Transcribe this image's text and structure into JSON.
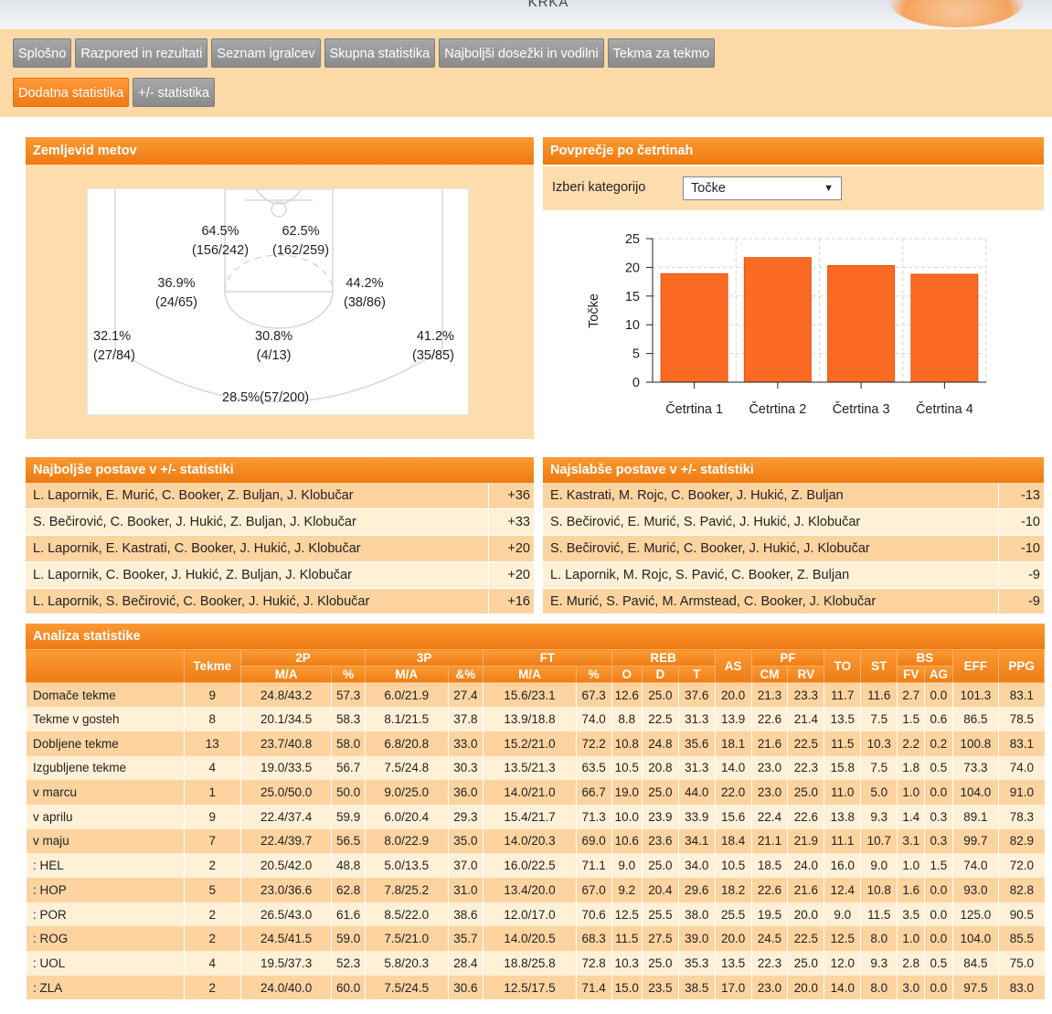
{
  "header": {
    "title": "KRKA"
  },
  "nav": {
    "row1": [
      "Splošno",
      "Razpored in rezultati",
      "Seznam igralcev",
      "Skupna statistika",
      "Najboljši dosežki in vodilni",
      "Tekma za tekmo"
    ],
    "row2": [
      "Dodatna statistika",
      "+/- statistika"
    ],
    "active": "Dodatna statistika"
  },
  "shot_map": {
    "title": "Zemljevid metov",
    "zones": {
      "paint_left": [
        "64.5%",
        "(156/242)"
      ],
      "paint_right": [
        "62.5%",
        "(162/259)"
      ],
      "mid_left": [
        "36.9%",
        "(24/65)"
      ],
      "mid_right": [
        "44.2%",
        "(38/86)"
      ],
      "corner_left": [
        "32.1%",
        "(27/84)"
      ],
      "top_key": [
        "30.8%",
        "(4/13)"
      ],
      "corner_right": [
        "41.2%",
        "(35/85)"
      ],
      "three_top": "28.5%(57/200)"
    }
  },
  "quarters": {
    "title": "Povprečje po četrtinah",
    "select_label": "Izberi kategorijo",
    "select_value": "Točke",
    "colors": {
      "bar": "#fb6a22",
      "bar_stroke": "#e25510"
    }
  },
  "chart_data": {
    "type": "bar",
    "categories": [
      "Četrtina 1",
      "Četrtina 2",
      "Četrtina 3",
      "Četrtina 4"
    ],
    "values": [
      18.9,
      21.7,
      20.3,
      18.8
    ],
    "ylabel": "Točke",
    "ylim": [
      0,
      25
    ],
    "yticks": [
      0,
      5,
      10,
      15,
      20,
      25
    ],
    "grid": true
  },
  "best_lineups": {
    "title": "Najboljše postave v +/- statistiki",
    "rows": [
      {
        "players": "L. Lapornik, E. Murić, C. Booker, Z. Buljan, J. Klobučar",
        "value": "+36"
      },
      {
        "players": "S. Bečirović, C. Booker, J. Hukić, Z. Buljan, J. Klobučar",
        "value": "+33"
      },
      {
        "players": "L. Lapornik, E. Kastrati, C. Booker, J. Hukić, J. Klobučar",
        "value": "+20"
      },
      {
        "players": "L. Lapornik, C. Booker, J. Hukić, Z. Buljan, J. Klobučar",
        "value": "+20"
      },
      {
        "players": "L. Lapornik, S. Bečirović, C. Booker, J. Hukić, J. Klobučar",
        "value": "+16"
      }
    ]
  },
  "worst_lineups": {
    "title": "Najslabše postave v +/- statistiki",
    "rows": [
      {
        "players": "E. Kastrati, M. Rojc, C. Booker, J. Hukić, Z. Buljan",
        "value": "-13"
      },
      {
        "players": "S. Bečirović, E. Murić, S. Pavić, J. Hukić, J. Klobučar",
        "value": "-10"
      },
      {
        "players": "S. Bečirović, E. Murić, C. Booker, J. Hukić, J. Klobučar",
        "value": "-10"
      },
      {
        "players": "L. Lapornik, M. Rojc, S. Pavić, C. Booker, Z. Buljan",
        "value": "-9"
      },
      {
        "players": "E. Murić, S. Pavić, M. Armstead, C. Booker, J. Klobučar",
        "value": "-9"
      }
    ]
  },
  "analysis": {
    "title": "Analiza statistike",
    "group_headers": [
      "Tekme",
      "2P",
      "3P",
      "FT",
      "REB",
      "AS",
      "PF",
      "TO",
      "ST",
      "BS",
      "EFF",
      "PPG"
    ],
    "sub_headers": [
      "M/A",
      "%",
      "M/A",
      "&%",
      "M/A",
      "%",
      "O",
      "D",
      "T",
      "CM",
      "RV",
      "FV",
      "AG"
    ],
    "rows": [
      [
        "Domače tekme",
        "9",
        "24.8/43.2",
        "57.3",
        "6.0/21.9",
        "27.4",
        "15.6/23.1",
        "67.3",
        "12.6",
        "25.0",
        "37.6",
        "20.0",
        "21.3",
        "23.3",
        "11.7",
        "11.6",
        "2.7",
        "0.0",
        "101.3",
        "83.1"
      ],
      [
        "Tekme v gosteh",
        "8",
        "20.1/34.5",
        "58.3",
        "8.1/21.5",
        "37.8",
        "13.9/18.8",
        "74.0",
        "8.8",
        "22.5",
        "31.3",
        "13.9",
        "22.6",
        "21.4",
        "13.5",
        "7.5",
        "1.5",
        "0.6",
        "86.5",
        "78.5"
      ],
      [
        "Dobljene tekme",
        "13",
        "23.7/40.8",
        "58.0",
        "6.8/20.8",
        "33.0",
        "15.2/21.0",
        "72.2",
        "10.8",
        "24.8",
        "35.6",
        "18.1",
        "21.6",
        "22.5",
        "11.5",
        "10.3",
        "2.2",
        "0.2",
        "100.8",
        "83.1"
      ],
      [
        "Izgubljene tekme",
        "4",
        "19.0/33.5",
        "56.7",
        "7.5/24.8",
        "30.3",
        "13.5/21.3",
        "63.5",
        "10.5",
        "20.8",
        "31.3",
        "14.0",
        "23.0",
        "22.3",
        "15.8",
        "7.5",
        "1.8",
        "0.5",
        "73.3",
        "74.0"
      ],
      [
        "v marcu",
        "1",
        "25.0/50.0",
        "50.0",
        "9.0/25.0",
        "36.0",
        "14.0/21.0",
        "66.7",
        "19.0",
        "25.0",
        "44.0",
        "22.0",
        "23.0",
        "25.0",
        "11.0",
        "5.0",
        "1.0",
        "0.0",
        "104.0",
        "91.0"
      ],
      [
        "v aprilu",
        "9",
        "22.4/37.4",
        "59.9",
        "6.0/20.4",
        "29.3",
        "15.4/21.7",
        "71.3",
        "10.0",
        "23.9",
        "33.9",
        "15.6",
        "22.4",
        "22.6",
        "13.8",
        "9.3",
        "1.4",
        "0.3",
        "89.1",
        "78.3"
      ],
      [
        "v maju",
        "7",
        "22.4/39.7",
        "56.5",
        "8.0/22.9",
        "35.0",
        "14.0/20.3",
        "69.0",
        "10.6",
        "23.6",
        "34.1",
        "18.4",
        "21.1",
        "21.9",
        "11.1",
        "10.7",
        "3.1",
        "0.3",
        "99.7",
        "82.9"
      ],
      [
        ": HEL",
        "2",
        "20.5/42.0",
        "48.8",
        "5.0/13.5",
        "37.0",
        "16.0/22.5",
        "71.1",
        "9.0",
        "25.0",
        "34.0",
        "10.5",
        "18.5",
        "24.0",
        "16.0",
        "9.0",
        "1.0",
        "1.5",
        "74.0",
        "72.0"
      ],
      [
        ": HOP",
        "5",
        "23.0/36.6",
        "62.8",
        "7.8/25.2",
        "31.0",
        "13.4/20.0",
        "67.0",
        "9.2",
        "20.4",
        "29.6",
        "18.2",
        "22.6",
        "21.6",
        "12.4",
        "10.8",
        "1.6",
        "0.0",
        "93.0",
        "82.8"
      ],
      [
        ": POR",
        "2",
        "26.5/43.0",
        "61.6",
        "8.5/22.0",
        "38.6",
        "12.0/17.0",
        "70.6",
        "12.5",
        "25.5",
        "38.0",
        "25.5",
        "19.5",
        "20.0",
        "9.0",
        "11.5",
        "3.5",
        "0.0",
        "125.0",
        "90.5"
      ],
      [
        ": ROG",
        "2",
        "24.5/41.5",
        "59.0",
        "7.5/21.0",
        "35.7",
        "14.0/20.5",
        "68.3",
        "11.5",
        "27.5",
        "39.0",
        "20.0",
        "24.5",
        "22.5",
        "12.5",
        "8.0",
        "1.0",
        "0.0",
        "104.0",
        "85.5"
      ],
      [
        ": UOL",
        "4",
        "19.5/37.3",
        "52.3",
        "5.8/20.3",
        "28.4",
        "18.8/25.8",
        "72.8",
        "10.3",
        "25.0",
        "35.3",
        "13.5",
        "22.3",
        "25.0",
        "12.0",
        "9.3",
        "2.8",
        "0.5",
        "84.5",
        "75.0"
      ],
      [
        ": ZLA",
        "2",
        "24.0/40.0",
        "60.0",
        "7.5/24.5",
        "30.6",
        "12.5/17.5",
        "71.4",
        "15.0",
        "23.5",
        "38.5",
        "17.0",
        "23.0",
        "20.0",
        "14.0",
        "8.0",
        "3.0",
        "0.0",
        "97.5",
        "83.0"
      ]
    ]
  }
}
